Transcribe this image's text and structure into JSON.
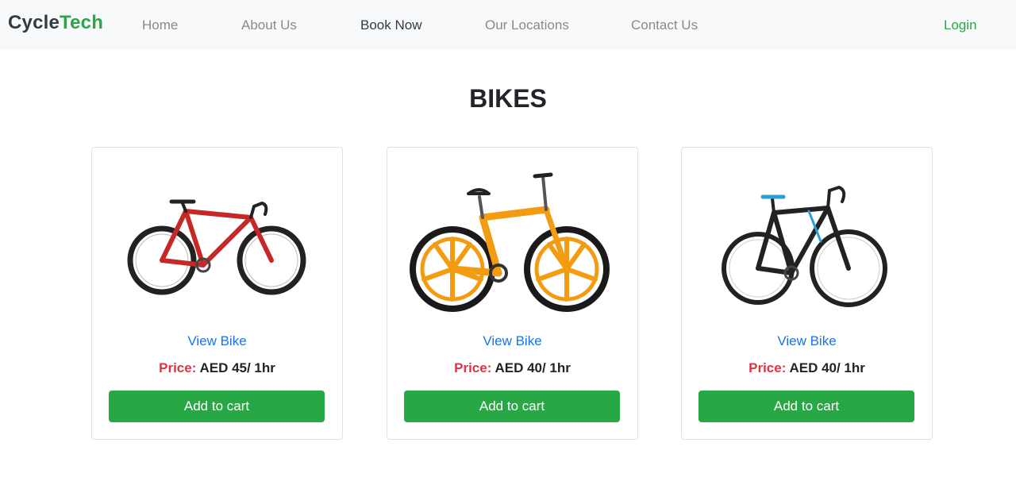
{
  "nav": {
    "brand_part1": "Cycle",
    "brand_part2": "Tech",
    "links": [
      "Home",
      "About Us",
      "Book Now",
      "Our Locations",
      "Contact Us"
    ],
    "active": "Book Now",
    "login": "Login"
  },
  "page": {
    "title": "BIKES"
  },
  "products": [
    {
      "view_label": "View Bike",
      "price_label": "Price:",
      "price_value": "AED 45/ 1hr",
      "cart_label": "Add to cart",
      "bike_color": "#c62828"
    },
    {
      "view_label": "View Bike",
      "price_label": "Price:",
      "price_value": "AED 40/ 1hr",
      "cart_label": "Add to cart",
      "bike_color": "#f39c12"
    },
    {
      "view_label": "View Bike",
      "price_label": "Price:",
      "price_value": "AED 40/ 1hr",
      "cart_label": "Add to cart",
      "bike_color": "#222222"
    }
  ],
  "colors": {
    "accent": "#28a745",
    "link": "#1a73e8",
    "price_label": "#dc3545",
    "navbar_bg": "#f8f9fa"
  }
}
